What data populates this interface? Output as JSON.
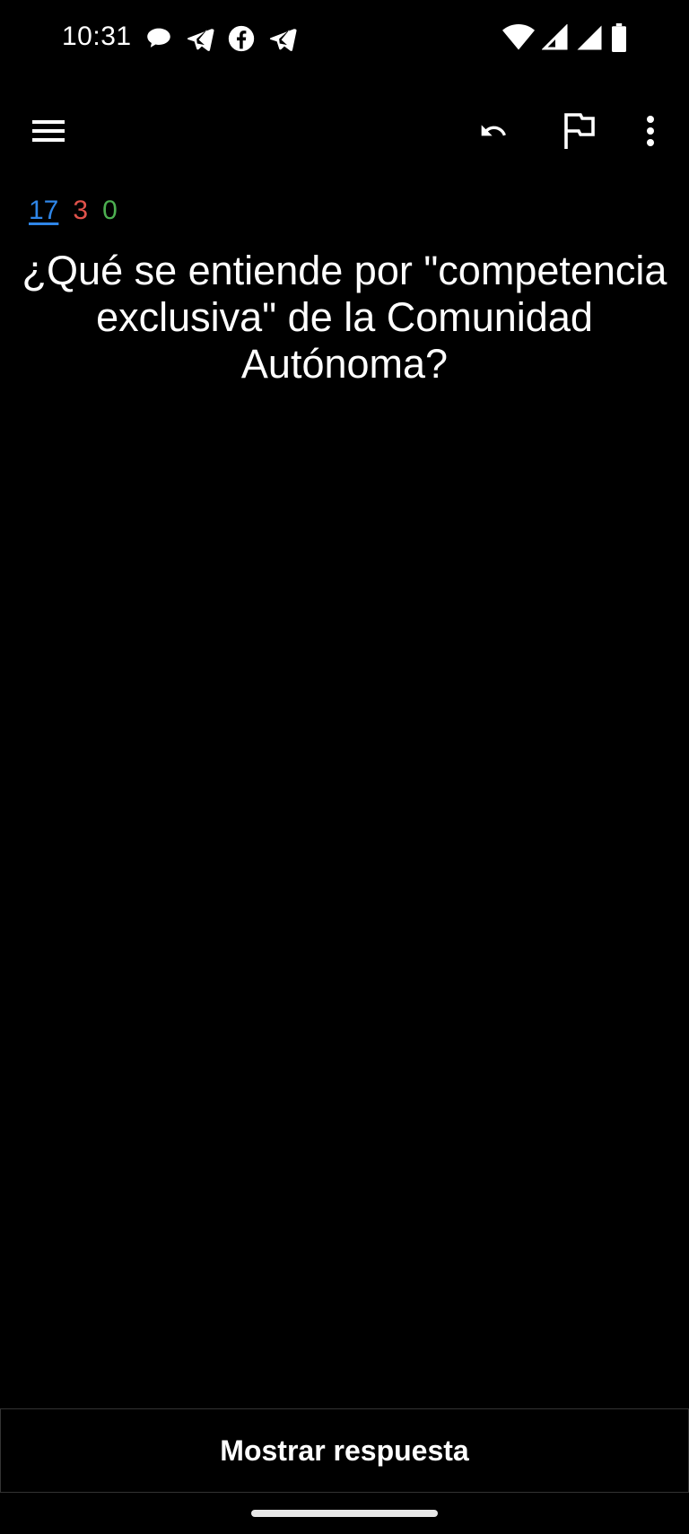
{
  "status_bar": {
    "time": "10:31",
    "notification_icons": [
      "chat-bubble-icon",
      "telegram-icon",
      "facebook-icon",
      "telegram-icon"
    ],
    "system_icons": [
      "wifi-icon",
      "signal-icon",
      "signal-icon",
      "battery-icon"
    ]
  },
  "toolbar": {
    "icons": [
      "menu-icon",
      "undo-icon",
      "flag-icon",
      "more-vert-icon"
    ]
  },
  "counts": {
    "new": "17",
    "learning": "3",
    "review": "0",
    "colors": {
      "new": "#2f86e8",
      "learning": "#e0524b",
      "review": "#4caf50"
    }
  },
  "card": {
    "question": "¿Qué se entiende por \"competencia exclusiva\" de la Comunidad Autónoma?"
  },
  "footer": {
    "show_answer_label": "Mostrar respuesta"
  }
}
